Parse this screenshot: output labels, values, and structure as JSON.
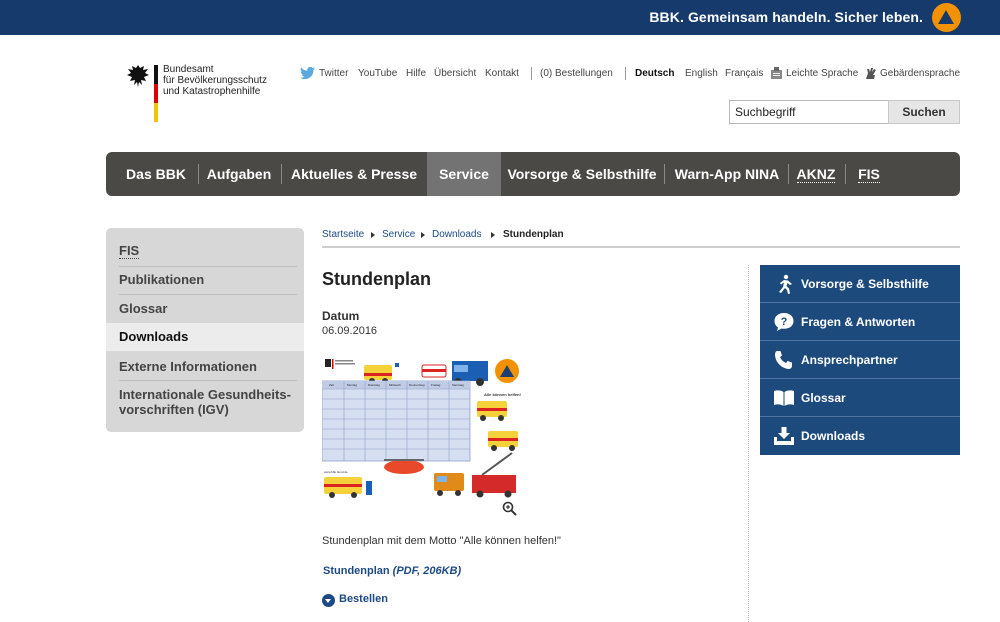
{
  "banner": {
    "slogan": "BBK. Gemeinsam handeln. Sicher leben.",
    "logo_color": "#f39200",
    "bg_color": "#163a6b"
  },
  "org": {
    "line1": "Bundesamt",
    "line2": "für Bevölkerungsschutz",
    "line3": "und Katastrophenhilfe"
  },
  "service_nav": {
    "twitter": "Twitter",
    "youtube": "YouTube",
    "hilfe": "Hilfe",
    "uebersicht": "Übersicht",
    "kontakt": "Kontakt",
    "bestellungen": "(0) Bestellungen",
    "deutsch": "Deutsch",
    "english": "English",
    "francais": "Français",
    "leichte_sprache": "Leichte Sprache",
    "gebaerdensprache": "Gebärdensprache"
  },
  "search": {
    "value": "Suchbegriff",
    "button": "Suchen"
  },
  "main_nav": [
    "Das BBK",
    "Aufgaben",
    "Aktuelles & Presse",
    "Service",
    "Vorsorge & Selbsthilfe",
    "Warn-App NINA",
    "AKNZ",
    "FIS"
  ],
  "side_nav": [
    "FIS",
    "Publikationen",
    "Glossar",
    "Downloads",
    "Externe Informationen",
    "Internationale Gesundheits-",
    "vorschriften (IGV)"
  ],
  "breadcrumb": [
    "Startseite",
    "Service",
    "Downloads",
    "Stundenplan"
  ],
  "content": {
    "title": "Stundenplan",
    "date_label": "Datum",
    "date_value": "06.09.2016",
    "description": "Stundenplan mit dem Motto \"Alle können helfen!\"",
    "download_name": "Stundenplan",
    "download_meta": "(PDF, 206KB)",
    "order": "Bestellen"
  },
  "thumbnail": {
    "motto": "Alle können helfen!",
    "days": [
      "Zeit",
      "Montag",
      "Dienstag",
      "Mittwoch",
      "Donnerstag",
      "Freitag",
      "Samstag"
    ],
    "url_text": "www.bbk.bund.de"
  },
  "quick_links": [
    "Vorsorge & Selbsthilfe",
    "Fragen & Antworten",
    "Ansprechpartner",
    "Glossar",
    "Downloads"
  ],
  "colors": {
    "nav_bg": "#4a4945",
    "nav_active": "#737373",
    "link": "#1d4a85",
    "quick_bg": "#1d4a7c"
  }
}
